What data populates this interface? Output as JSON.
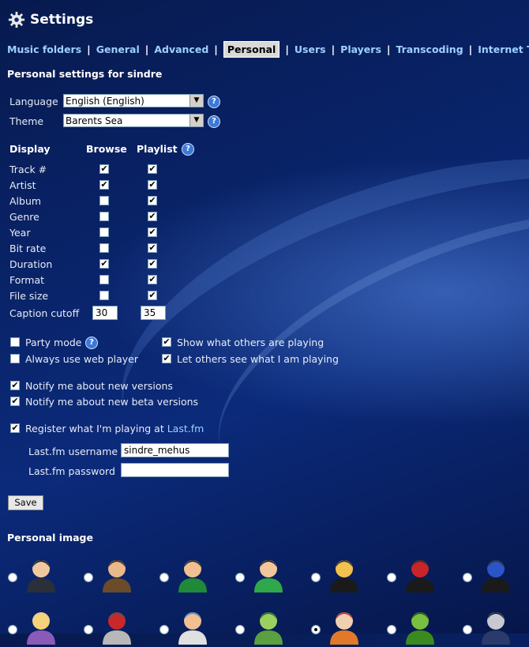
{
  "header": {
    "title": "Settings"
  },
  "tabs": [
    {
      "label": "Music folders",
      "active": false
    },
    {
      "label": "General",
      "active": false
    },
    {
      "label": "Advanced",
      "active": false
    },
    {
      "label": "Personal",
      "active": true
    },
    {
      "label": "Users",
      "active": false
    },
    {
      "label": "Players",
      "active": false
    },
    {
      "label": "Transcoding",
      "active": false
    },
    {
      "label": "Internet TV",
      "active": false
    }
  ],
  "section_title": "Personal settings for sindre",
  "language": {
    "label": "Language",
    "value": "English (English)"
  },
  "theme": {
    "label": "Theme",
    "value": "Barents Sea"
  },
  "help_glyph": "?",
  "display": {
    "header_display": "Display",
    "header_browse": "Browse",
    "header_playlist": "Playlist",
    "rows": [
      {
        "label": "Track #",
        "browse": true,
        "playlist": true
      },
      {
        "label": "Artist",
        "browse": true,
        "playlist": true
      },
      {
        "label": "Album",
        "browse": false,
        "playlist": true
      },
      {
        "label": "Genre",
        "browse": false,
        "playlist": true
      },
      {
        "label": "Year",
        "browse": false,
        "playlist": true
      },
      {
        "label": "Bit rate",
        "browse": false,
        "playlist": true
      },
      {
        "label": "Duration",
        "browse": true,
        "playlist": true
      },
      {
        "label": "Format",
        "browse": false,
        "playlist": true
      },
      {
        "label": "File size",
        "browse": false,
        "playlist": true
      }
    ],
    "caption_cutoff": {
      "label": "Caption cutoff",
      "browse": "30",
      "playlist": "35"
    }
  },
  "options": {
    "party_mode": {
      "label": "Party mode",
      "checked": false
    },
    "show_others": {
      "label": "Show what others are playing",
      "checked": true
    },
    "always_web": {
      "label": "Always use web player",
      "checked": false
    },
    "let_others": {
      "label": "Let others see what I am playing",
      "checked": true
    },
    "notify_versions": {
      "label": "Notify me about new versions",
      "checked": true
    },
    "notify_beta": {
      "label": "Notify me about new beta versions",
      "checked": true
    },
    "lastfm_register": {
      "label_prefix": "Register what I'm playing at ",
      "label_link": "Last.fm",
      "checked": true
    }
  },
  "lastfm": {
    "username_label": "Last.fm username",
    "username_value": "sindre_mehus",
    "password_label": "Last.fm password",
    "password_value": ""
  },
  "save_label": "Save",
  "personal_image": {
    "title": "Personal image",
    "selected_index": 11,
    "avatars": [
      "businessman-icon",
      "business-man-orange-tie-icon",
      "soccer-player-icon",
      "green-shirt-man-icon",
      "hooded-monk-yellow-icon",
      "hooded-monk-red-icon",
      "hooded-monk-blue-icon",
      "blonde-woman-icon",
      "masked-fighter-icon",
      "shower-man-icon",
      "zombie-icon",
      "clown-icon",
      "tree-monster-icon",
      "police-robot-icon"
    ]
  },
  "colors": {
    "link": "#9fd0ff",
    "background": "#0a2670"
  }
}
